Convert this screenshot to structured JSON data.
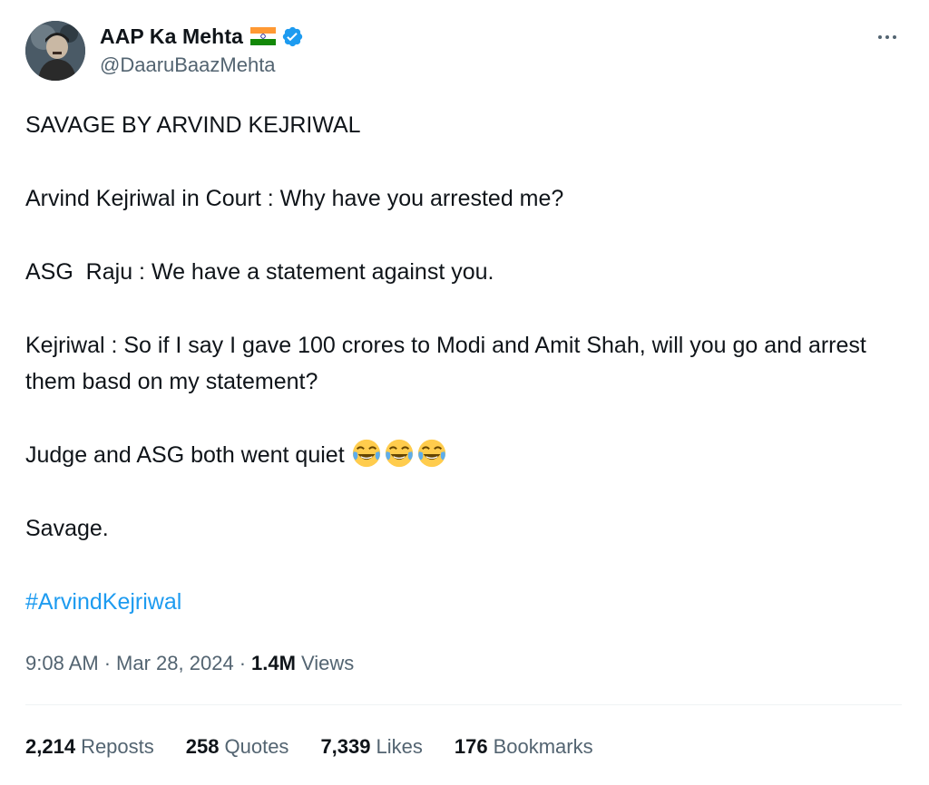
{
  "author": {
    "display_name": "AAP Ka Mehta",
    "handle": "@DaaruBaazMehta",
    "flag_icon": "india-flag-icon",
    "verified_icon": "verified-badge-icon",
    "verified_color": "#1d9bf0"
  },
  "more_icon": "more-horizontal-icon",
  "tweet": {
    "lines": [
      "SAVAGE BY ARVIND KEJRIWAL",
      "Arvind Kejriwal in Court : Why have you arrested me?",
      "ASG  Raju : We have a statement against you.",
      "Kejriwal : So if I say I gave 100 crores to Modi and Amit Shah, will you go and arrest them basd on my statement?",
      "Judge and ASG both went quiet",
      "Savage."
    ],
    "emoji": [
      "😂",
      "😂",
      "😂"
    ],
    "emoji_icon": "face-with-tears-of-joy-icon",
    "hashtag": "#ArvindKejriwal",
    "hashtag_color": "#1d9bf0"
  },
  "meta": {
    "time": "9:08 AM",
    "separator": "·",
    "date": "Mar 28, 2024",
    "views_count": "1.4M",
    "views_label": "Views"
  },
  "stats": {
    "reposts_count": "2,214",
    "reposts_label": "Reposts",
    "quotes_count": "258",
    "quotes_label": "Quotes",
    "likes_count": "7,339",
    "likes_label": "Likes",
    "bookmarks_count": "176",
    "bookmarks_label": "Bookmarks"
  }
}
